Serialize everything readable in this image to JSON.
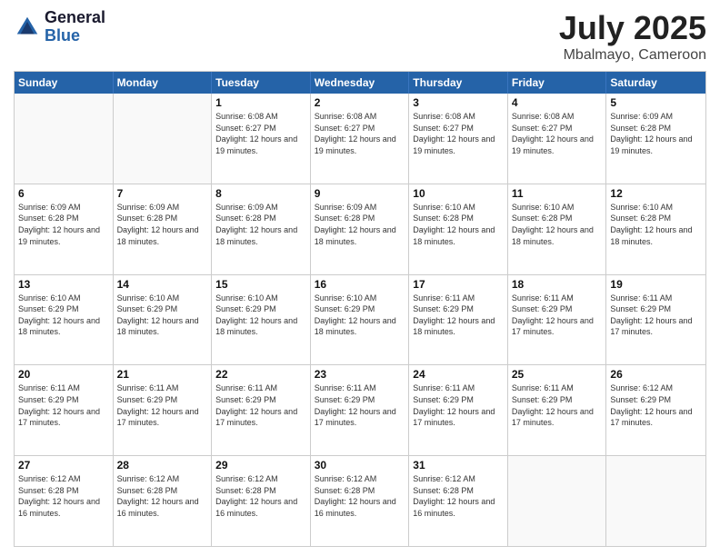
{
  "header": {
    "logo_general": "General",
    "logo_blue": "Blue",
    "title": "July 2025",
    "location": "Mbalmayo, Cameroon"
  },
  "weekdays": [
    "Sunday",
    "Monday",
    "Tuesday",
    "Wednesday",
    "Thursday",
    "Friday",
    "Saturday"
  ],
  "weeks": [
    [
      {
        "day": "",
        "info": ""
      },
      {
        "day": "",
        "info": ""
      },
      {
        "day": "1",
        "info": "Sunrise: 6:08 AM\nSunset: 6:27 PM\nDaylight: 12 hours and 19 minutes."
      },
      {
        "day": "2",
        "info": "Sunrise: 6:08 AM\nSunset: 6:27 PM\nDaylight: 12 hours and 19 minutes."
      },
      {
        "day": "3",
        "info": "Sunrise: 6:08 AM\nSunset: 6:27 PM\nDaylight: 12 hours and 19 minutes."
      },
      {
        "day": "4",
        "info": "Sunrise: 6:08 AM\nSunset: 6:27 PM\nDaylight: 12 hours and 19 minutes."
      },
      {
        "day": "5",
        "info": "Sunrise: 6:09 AM\nSunset: 6:28 PM\nDaylight: 12 hours and 19 minutes."
      }
    ],
    [
      {
        "day": "6",
        "info": "Sunrise: 6:09 AM\nSunset: 6:28 PM\nDaylight: 12 hours and 19 minutes."
      },
      {
        "day": "7",
        "info": "Sunrise: 6:09 AM\nSunset: 6:28 PM\nDaylight: 12 hours and 18 minutes."
      },
      {
        "day": "8",
        "info": "Sunrise: 6:09 AM\nSunset: 6:28 PM\nDaylight: 12 hours and 18 minutes."
      },
      {
        "day": "9",
        "info": "Sunrise: 6:09 AM\nSunset: 6:28 PM\nDaylight: 12 hours and 18 minutes."
      },
      {
        "day": "10",
        "info": "Sunrise: 6:10 AM\nSunset: 6:28 PM\nDaylight: 12 hours and 18 minutes."
      },
      {
        "day": "11",
        "info": "Sunrise: 6:10 AM\nSunset: 6:28 PM\nDaylight: 12 hours and 18 minutes."
      },
      {
        "day": "12",
        "info": "Sunrise: 6:10 AM\nSunset: 6:28 PM\nDaylight: 12 hours and 18 minutes."
      }
    ],
    [
      {
        "day": "13",
        "info": "Sunrise: 6:10 AM\nSunset: 6:29 PM\nDaylight: 12 hours and 18 minutes."
      },
      {
        "day": "14",
        "info": "Sunrise: 6:10 AM\nSunset: 6:29 PM\nDaylight: 12 hours and 18 minutes."
      },
      {
        "day": "15",
        "info": "Sunrise: 6:10 AM\nSunset: 6:29 PM\nDaylight: 12 hours and 18 minutes."
      },
      {
        "day": "16",
        "info": "Sunrise: 6:10 AM\nSunset: 6:29 PM\nDaylight: 12 hours and 18 minutes."
      },
      {
        "day": "17",
        "info": "Sunrise: 6:11 AM\nSunset: 6:29 PM\nDaylight: 12 hours and 18 minutes."
      },
      {
        "day": "18",
        "info": "Sunrise: 6:11 AM\nSunset: 6:29 PM\nDaylight: 12 hours and 17 minutes."
      },
      {
        "day": "19",
        "info": "Sunrise: 6:11 AM\nSunset: 6:29 PM\nDaylight: 12 hours and 17 minutes."
      }
    ],
    [
      {
        "day": "20",
        "info": "Sunrise: 6:11 AM\nSunset: 6:29 PM\nDaylight: 12 hours and 17 minutes."
      },
      {
        "day": "21",
        "info": "Sunrise: 6:11 AM\nSunset: 6:29 PM\nDaylight: 12 hours and 17 minutes."
      },
      {
        "day": "22",
        "info": "Sunrise: 6:11 AM\nSunset: 6:29 PM\nDaylight: 12 hours and 17 minutes."
      },
      {
        "day": "23",
        "info": "Sunrise: 6:11 AM\nSunset: 6:29 PM\nDaylight: 12 hours and 17 minutes."
      },
      {
        "day": "24",
        "info": "Sunrise: 6:11 AM\nSunset: 6:29 PM\nDaylight: 12 hours and 17 minutes."
      },
      {
        "day": "25",
        "info": "Sunrise: 6:11 AM\nSunset: 6:29 PM\nDaylight: 12 hours and 17 minutes."
      },
      {
        "day": "26",
        "info": "Sunrise: 6:12 AM\nSunset: 6:29 PM\nDaylight: 12 hours and 17 minutes."
      }
    ],
    [
      {
        "day": "27",
        "info": "Sunrise: 6:12 AM\nSunset: 6:28 PM\nDaylight: 12 hours and 16 minutes."
      },
      {
        "day": "28",
        "info": "Sunrise: 6:12 AM\nSunset: 6:28 PM\nDaylight: 12 hours and 16 minutes."
      },
      {
        "day": "29",
        "info": "Sunrise: 6:12 AM\nSunset: 6:28 PM\nDaylight: 12 hours and 16 minutes."
      },
      {
        "day": "30",
        "info": "Sunrise: 6:12 AM\nSunset: 6:28 PM\nDaylight: 12 hours and 16 minutes."
      },
      {
        "day": "31",
        "info": "Sunrise: 6:12 AM\nSunset: 6:28 PM\nDaylight: 12 hours and 16 minutes."
      },
      {
        "day": "",
        "info": ""
      },
      {
        "day": "",
        "info": ""
      }
    ]
  ]
}
